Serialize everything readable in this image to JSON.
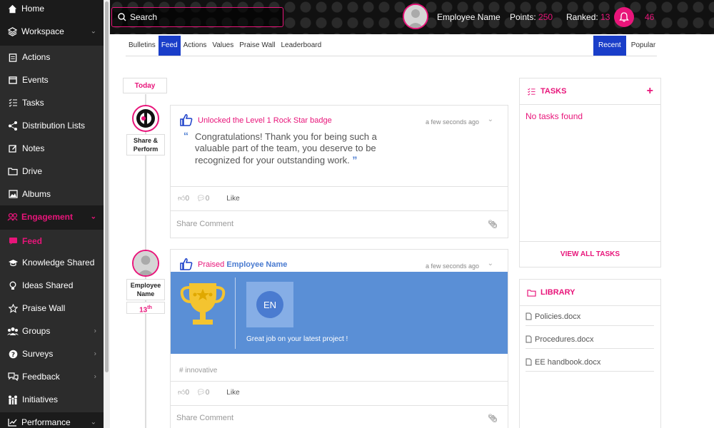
{
  "sidebar": {
    "items": [
      {
        "label": "Home",
        "icon": "home-icon"
      },
      {
        "label": "Workspace",
        "icon": "layers-icon"
      },
      {
        "label": "Actions",
        "icon": "clipboard-icon"
      },
      {
        "label": "Events",
        "icon": "calendar-icon"
      },
      {
        "label": "Tasks",
        "icon": "checklist-icon"
      },
      {
        "label": "Distribution Lists",
        "icon": "share-nodes-icon"
      },
      {
        "label": "Notes",
        "icon": "edit-icon"
      },
      {
        "label": "Drive",
        "icon": "folder-icon"
      },
      {
        "label": "Albums",
        "icon": "image-icon"
      },
      {
        "label": "Engagement",
        "icon": "users-icon"
      },
      {
        "label": "Feed",
        "icon": "chat-icon"
      },
      {
        "label": "Knowledge Shared",
        "icon": "graduation-icon"
      },
      {
        "label": "Ideas Shared",
        "icon": "lightbulb-icon"
      },
      {
        "label": "Praise Wall",
        "icon": "star-icon"
      },
      {
        "label": "Groups",
        "icon": "group-icon"
      },
      {
        "label": "Surveys",
        "icon": "question-icon"
      },
      {
        "label": "Feedback",
        "icon": "comments-icon"
      },
      {
        "label": "Initiatives",
        "icon": "people-icon"
      },
      {
        "label": "Performance",
        "icon": "chart-icon"
      }
    ]
  },
  "topbar": {
    "search_label": "Search",
    "user_name": "Employee Name",
    "points_label": "Points:",
    "points_value": "250",
    "ranked_label": "Ranked:",
    "ranked_value": "13",
    "notification_count": "46"
  },
  "tabs": [
    "Bulletins",
    "Feed",
    "Actions",
    "Values",
    "Praise Wall",
    "Leaderboard"
  ],
  "sort_tabs": [
    "Recent",
    "Popular"
  ],
  "timeline": {
    "today_label": "Today",
    "post1_label_line1": "Share &",
    "post1_label_line2": "Perform",
    "post2_label_line1": "Employee",
    "post2_label_line2": "Name",
    "post2_rank": "13",
    "post2_rank_suffix": "th"
  },
  "posts": [
    {
      "title": "Unlocked the Level 1 Rock Star badge",
      "time": "a few seconds ago",
      "quote": "Congratulations! Thank you for being such a valuable part of the team, you deserve to be recognized for your outstanding work.",
      "likes": "0",
      "comments": "0",
      "like_label": "Like",
      "comment_placeholder": "Share Comment"
    },
    {
      "title_prefix": "Praised",
      "title_name": "Employee Name",
      "time": "a few seconds ago",
      "initials": "EN",
      "message": "Great job on your latest project !",
      "tag": "# innovative",
      "likes": "0",
      "comments": "0",
      "like_label": "Like",
      "comment_placeholder": "Share Comment"
    }
  ],
  "tasks_widget": {
    "title": "TASKS",
    "empty_text": "No tasks found",
    "view_all": "VIEW ALL TASKS"
  },
  "library_widget": {
    "title": "LIBRARY",
    "files": [
      "Policies.docx",
      "Procedures.docx",
      "EE handbook.docx"
    ]
  },
  "colors": {
    "accent": "#e8157a",
    "active_tab": "#1a3ec9",
    "banner": "#5a8fd6"
  }
}
